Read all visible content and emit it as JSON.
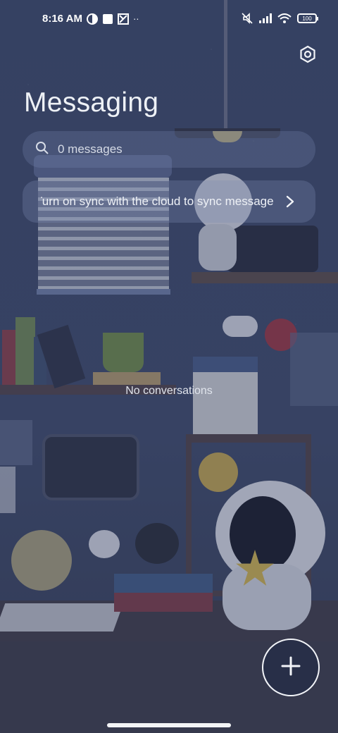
{
  "status_bar": {
    "time": "8:16 AM",
    "left_icons": [
      "contrast-icon",
      "square-notification-icon",
      "puzzle-notification-icon",
      "more-dots-icon"
    ],
    "more_dots": "··",
    "right_icons": [
      "mute-icon",
      "signal-icon",
      "wifi-icon",
      "battery-icon"
    ],
    "battery_level": "100"
  },
  "header": {
    "title": "Messaging"
  },
  "search": {
    "placeholder": "0 messages"
  },
  "sync_banner": {
    "text": "Turn on sync with the cloud to sync messages"
  },
  "conversations": {
    "empty_text": "No conversations"
  },
  "fab": {
    "icon": "plus-icon"
  },
  "colors": {
    "accent": "#f2f4f8",
    "background": "#3b4666"
  }
}
